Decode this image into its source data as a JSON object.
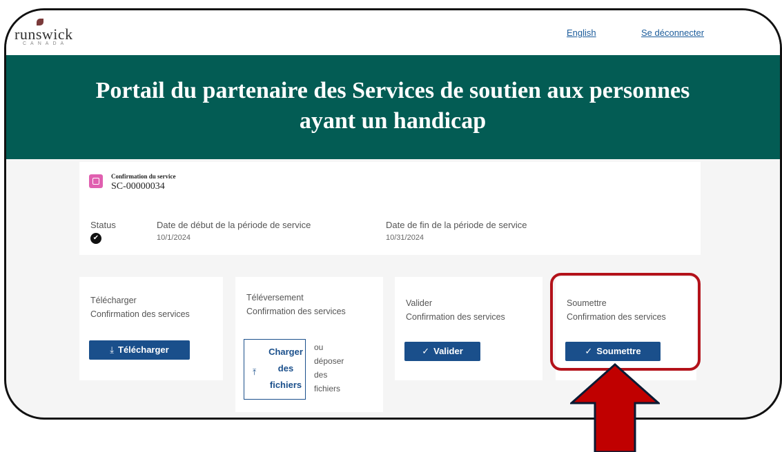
{
  "header": {
    "logo_text": "runswick",
    "logo_sub": "CANADA",
    "lang_link": "English",
    "logout_link": "Se déconnecter"
  },
  "hero": {
    "title": "Portail du partenaire des Services de soutien aux personnes ayant un handicap"
  },
  "service": {
    "label": "Confirmation du service",
    "number": "SC-00000034",
    "status_label": "Status",
    "start_label": "Date de début de la période de service",
    "start_value": "10/1/2024",
    "end_label": "Date de fin de la période de service",
    "end_value": "10/31/2024"
  },
  "actions": {
    "download": {
      "line1": "Télécharger",
      "line2": "Confirmation des services",
      "button": "Télécharger",
      "icon": "download-icon"
    },
    "upload": {
      "line1": "Téléversement",
      "line2": "Confirmation des services",
      "button": "Charger des fichiers",
      "drop_text": "ou déposer des fichiers",
      "icon": "upload-icon"
    },
    "validate": {
      "line1": "Valider",
      "line2": "Confirmation des services",
      "button": "Valider",
      "icon": "check-icon"
    },
    "submit": {
      "line1": "Soumettre",
      "line2": "Confirmation des services",
      "button": "Soumettre",
      "icon": "check-icon"
    }
  },
  "colors": {
    "hero_bg": "#035c54",
    "button_bg": "#1a4f8b",
    "highlight": "#b3121a",
    "status_badge": "#e060b0"
  }
}
